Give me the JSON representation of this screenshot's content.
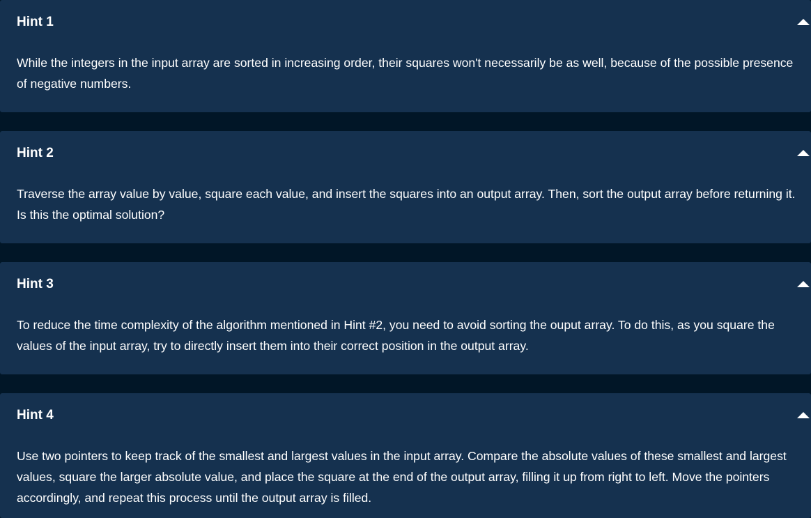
{
  "hints": [
    {
      "title": "Hint 1",
      "body": "While the integers in the input array are sorted in increasing order, their squares won't necessarily be as well, because of the possible presence of negative numbers."
    },
    {
      "title": "Hint 2",
      "body": "Traverse the array value by value, square each value, and insert the squares into an output array. Then, sort the output array before returning it. Is this the optimal solution?"
    },
    {
      "title": "Hint 3",
      "body": "To reduce the time complexity of the algorithm mentioned in Hint #2, you need to avoid sorting the ouput array. To do this, as you square the values of the input array, try to directly insert them into their correct position in the output array."
    },
    {
      "title": "Hint 4",
      "body": "Use two pointers to keep track of the smallest and largest values in the input array. Compare the absolute values of these smallest and largest values, square the larger absolute value, and place the square at the end of the output array, filling it up from right to left. Move the pointers accordingly, and repeat this process until the output array is filled."
    }
  ],
  "icons": {
    "toggle": "chevron-up-icon"
  },
  "colors": {
    "page_background": "#011627",
    "card_background": "#15314f",
    "text": "#ffffff"
  }
}
